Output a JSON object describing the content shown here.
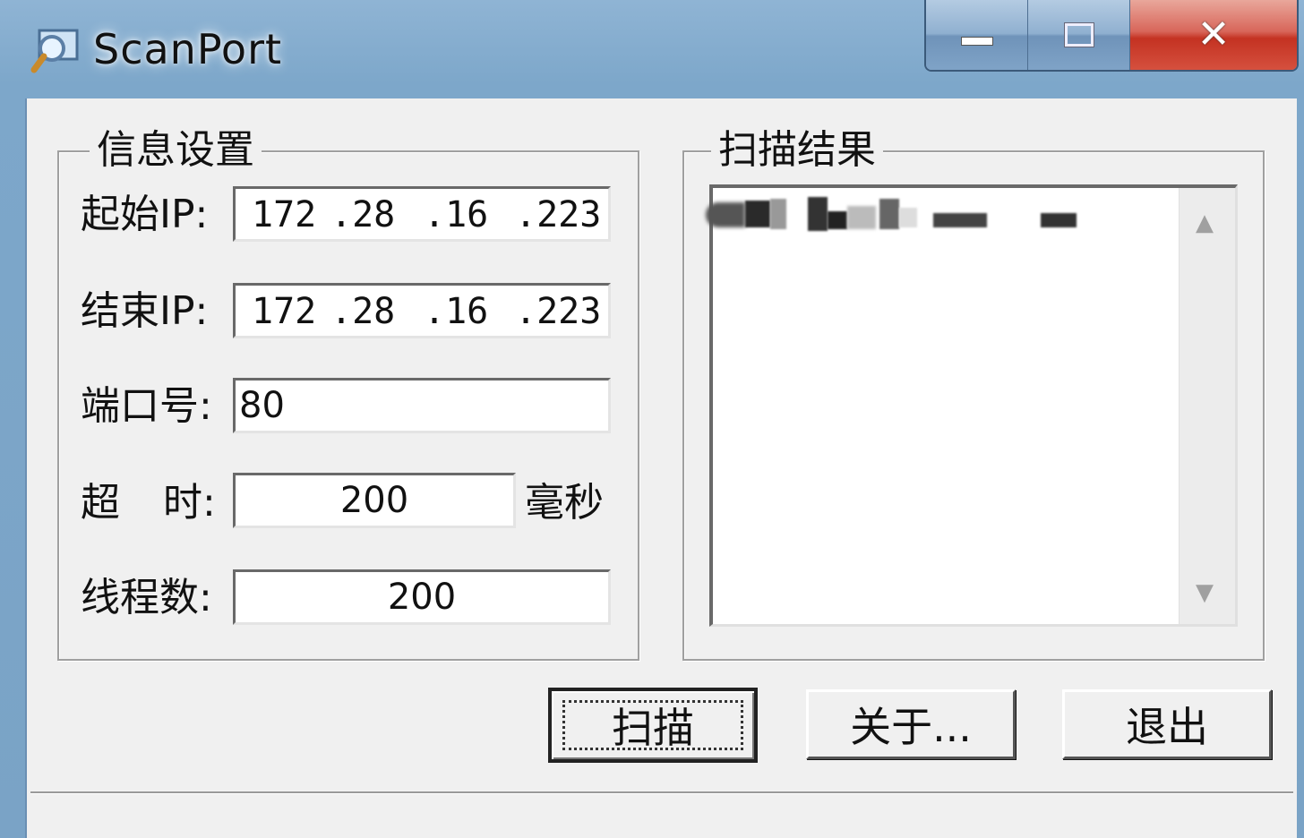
{
  "window": {
    "title": "ScanPort",
    "app_icon": "magnifier-icon",
    "minimize_icon": "minimize-icon",
    "maximize_icon": "maximize-icon",
    "close_icon": "close-icon",
    "close_glyph": "✕"
  },
  "settings": {
    "group_title": "信息设置",
    "start_ip_label": "起始IP:",
    "start_ip": [
      "172",
      ".28",
      ".16",
      ".223"
    ],
    "end_ip_label": "结束IP:",
    "end_ip": [
      "172",
      ".28",
      ".16",
      ".223"
    ],
    "port_label": "端口号:",
    "port_value": "80",
    "timeout_label_a": "超",
    "timeout_label_b": "时:",
    "timeout_value": "200",
    "timeout_unit": "毫秒",
    "threads_label": "线程数:",
    "threads_value": "200"
  },
  "results": {
    "group_title": "扫描结果",
    "up_arrow": "▲",
    "down_arrow": "▼"
  },
  "buttons": {
    "scan": "扫描",
    "about": "关于...",
    "exit": "退出"
  },
  "colors": {
    "title_bar": "#7aa6c9",
    "close_button": "#c43222",
    "client_bg": "#f0f0f0"
  }
}
